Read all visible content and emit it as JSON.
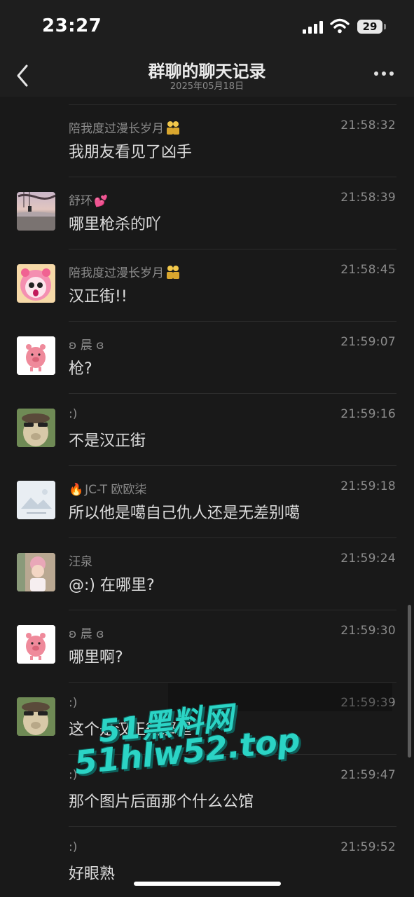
{
  "status_bar": {
    "time": "23:27",
    "battery": "29"
  },
  "nav": {
    "title": "群聊的聊天记录",
    "subtitle": "2025年05月18日"
  },
  "messages": [
    {
      "sender": "陪我度过漫长岁月",
      "sender_emoji": "couple-emoji",
      "time": "21:58:32",
      "text": "我朋友看见了凶手",
      "avatar": "none"
    },
    {
      "sender": "舒环",
      "sender_emoji": "heart-emoji",
      "time": "21:58:39",
      "text": "哪里枪杀的吖",
      "avatar": "sunset-swing"
    },
    {
      "sender": "陪我度过漫长岁月",
      "sender_emoji": "couple-emoji",
      "time": "21:58:45",
      "text": "汉正街!!",
      "avatar": "pink-cartoon"
    },
    {
      "sender": "ʚ 晨 ɞ",
      "time": "21:59:07",
      "text": "枪?",
      "avatar": "pink-pig"
    },
    {
      "sender": ":)",
      "time": "21:59:16",
      "text": "不是汉正街",
      "avatar": "alpaca"
    },
    {
      "sender": "JC-T 欧欧柒",
      "sender_emoji": "fire-emoji",
      "time": "21:59:18",
      "text": "所以他是噶自己仇人还是无差别噶",
      "avatar": "blank-image"
    },
    {
      "sender": "汪泉",
      "time": "21:59:24",
      "text": "@:) 在哪里?",
      "avatar": "girl-photo"
    },
    {
      "sender": "ʚ 晨 ɞ",
      "time": "21:59:30",
      "text": "哪里啊?",
      "avatar": "pink-pig"
    },
    {
      "sender": ":)",
      "time": "21:59:39",
      "text": "这个是汉正街那里",
      "avatar": "alpaca"
    },
    {
      "sender": ":)",
      "time": "21:59:47",
      "text": "那个图片后面那个什么公馆",
      "avatar": "none"
    },
    {
      "sender": ":)",
      "time": "21:59:52",
      "text": "好眼熟",
      "avatar": "none"
    }
  ],
  "watermark": {
    "line1": "51黑料网",
    "line2": "51hlw52.top"
  },
  "colors": {
    "background": "#191919",
    "text": "#dcdcdc",
    "meta": "#8c8c8c",
    "watermark": "#2bd4c5"
  }
}
